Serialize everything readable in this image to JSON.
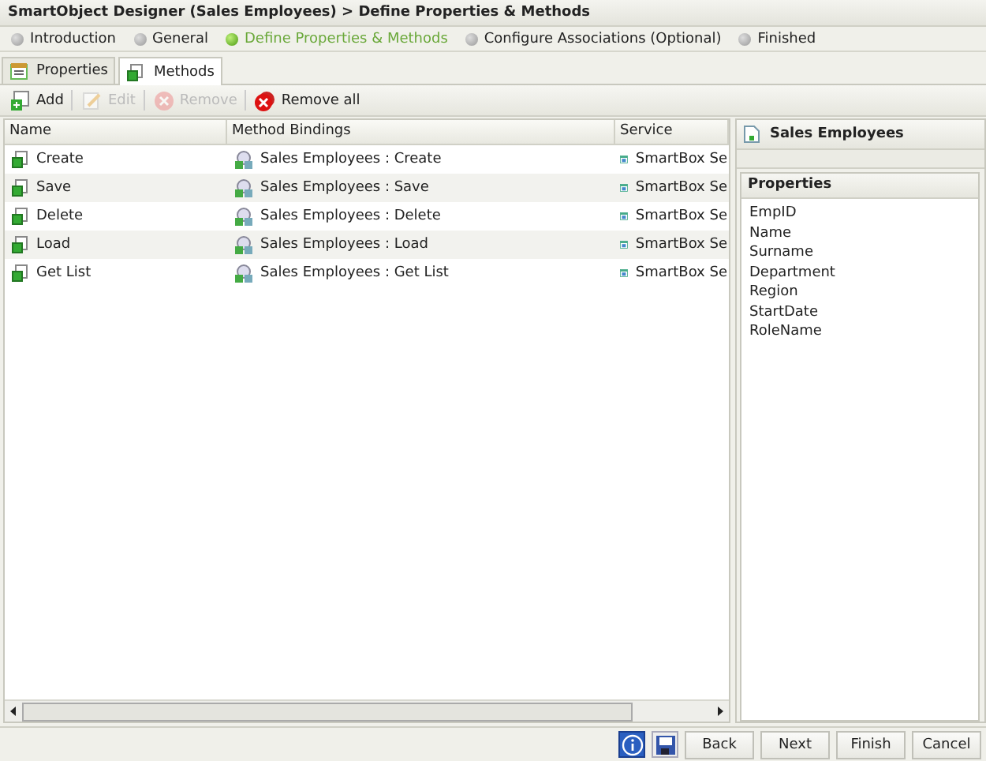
{
  "window": {
    "title": "SmartObject Designer (Sales Employees) > Define Properties & Methods"
  },
  "steps": [
    {
      "label": "Introduction",
      "selected": false
    },
    {
      "label": "General",
      "selected": false
    },
    {
      "label": "Define Properties & Methods",
      "selected": true
    },
    {
      "label": "Configure Associations (Optional)",
      "selected": false
    },
    {
      "label": "Finished",
      "selected": false
    }
  ],
  "tabs": [
    {
      "label": "Properties",
      "selected": false
    },
    {
      "label": "Methods",
      "selected": true
    }
  ],
  "toolbar": [
    {
      "kind": "add",
      "label": "Add",
      "disabled": false
    },
    {
      "kind": "edit",
      "label": "Edit",
      "disabled": true
    },
    {
      "kind": "remove",
      "label": "Remove",
      "disabled": true
    },
    {
      "kind": "remove_all",
      "label": "Remove all",
      "disabled": false
    }
  ],
  "table": {
    "columns": [
      "Name",
      "Method Bindings",
      "Service"
    ],
    "rows": [
      {
        "name": "Create",
        "binding": "Sales Employees : Create",
        "service": "SmartBox Se"
      },
      {
        "name": "Save",
        "binding": "Sales Employees : Save",
        "service": "SmartBox Se"
      },
      {
        "name": "Delete",
        "binding": "Sales Employees : Delete",
        "service": "SmartBox Se"
      },
      {
        "name": "Load",
        "binding": "Sales Employees : Load",
        "service": "SmartBox Se"
      },
      {
        "name": "Get List",
        "binding": "Sales Employees : Get List",
        "service": "SmartBox Se"
      }
    ]
  },
  "side_panel": {
    "title": "Sales Employees",
    "section": "Properties",
    "items": [
      "EmpID",
      "Name",
      "Surname",
      "Department",
      "Region",
      "StartDate",
      "RoleName"
    ]
  },
  "footer": {
    "buttons": [
      "Back",
      "Next",
      "Finish",
      "Cancel"
    ]
  }
}
